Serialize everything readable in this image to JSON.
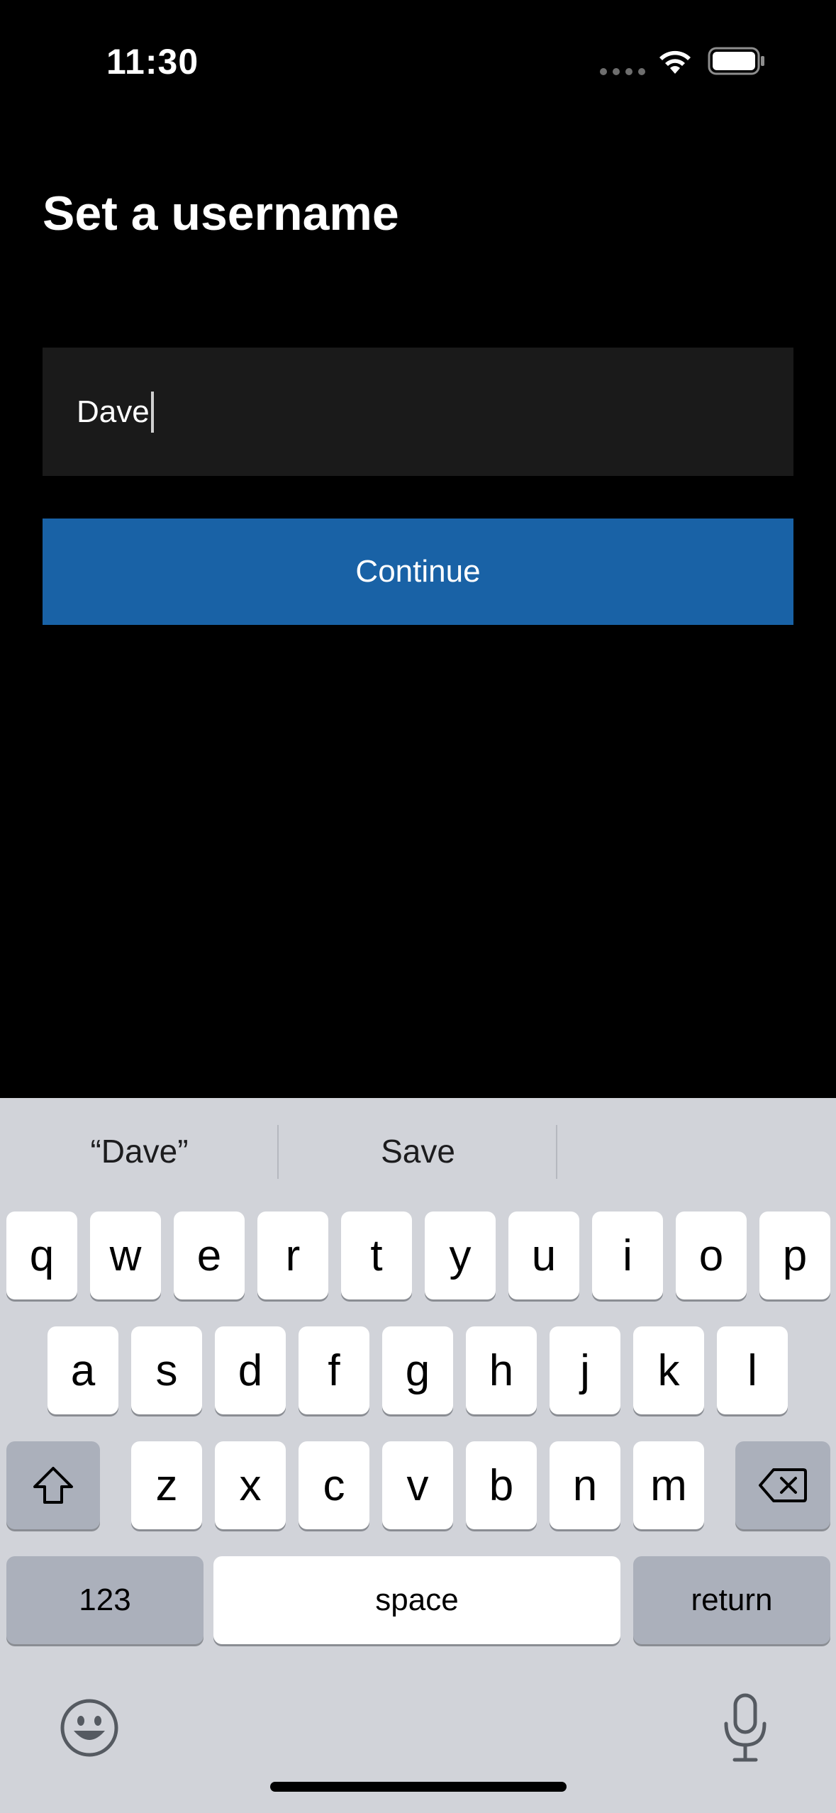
{
  "status_bar": {
    "time": "11:30",
    "icons": [
      "signal-dots-icon",
      "wifi-icon",
      "battery-icon"
    ]
  },
  "screen": {
    "title": "Set a username",
    "username_value": "Dave",
    "continue_label": "Continue"
  },
  "colors": {
    "background": "#000000",
    "field_background": "#1a1a1a",
    "accent": "#1962a6",
    "keyboard_background": "#d1d3d9"
  },
  "keyboard": {
    "suggestions": [
      "“Dave”",
      "Save",
      ""
    ],
    "row1": [
      "q",
      "w",
      "e",
      "r",
      "t",
      "y",
      "u",
      "i",
      "o",
      "p"
    ],
    "row2": [
      "a",
      "s",
      "d",
      "f",
      "g",
      "h",
      "j",
      "k",
      "l"
    ],
    "row3": [
      "z",
      "x",
      "c",
      "v",
      "b",
      "n",
      "m"
    ],
    "numbers_label": "123",
    "space_label": "space",
    "return_label": "return",
    "icons": [
      "shift-icon",
      "backspace-icon",
      "emoji-icon",
      "microphone-icon"
    ]
  }
}
